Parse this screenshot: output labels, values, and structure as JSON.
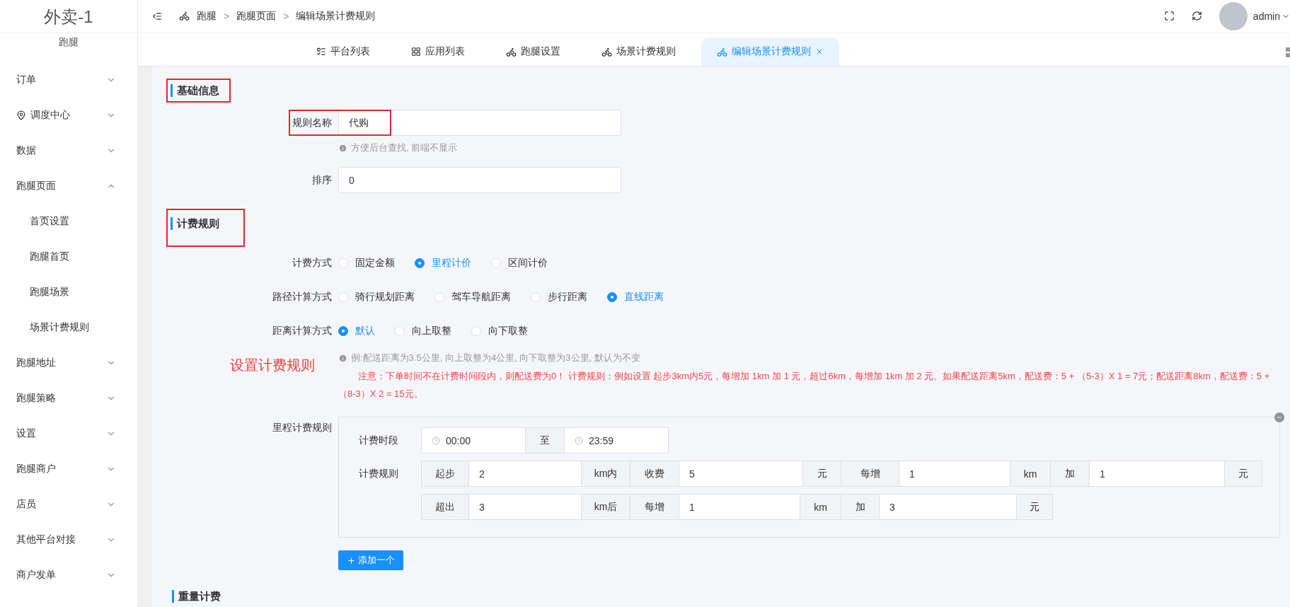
{
  "sidebar": {
    "title": "外卖-1",
    "subtitle": "跑腿",
    "items": [
      {
        "label": "订单",
        "kind": "plain",
        "expanded": false
      },
      {
        "label": "调度中心",
        "kind": "pin",
        "expanded": false
      },
      {
        "label": "数据",
        "kind": "plain",
        "expanded": false
      },
      {
        "label": "跑腿页面",
        "kind": "plain",
        "expanded": true,
        "children": [
          {
            "label": "首页设置"
          },
          {
            "label": "跑腿首页"
          },
          {
            "label": "跑腿场景"
          },
          {
            "label": "场景计费规则"
          }
        ]
      },
      {
        "label": "跑腿地址",
        "kind": "plain",
        "expanded": false
      },
      {
        "label": "跑腿策略",
        "kind": "plain",
        "expanded": false
      },
      {
        "label": "设置",
        "kind": "plain",
        "expanded": false
      },
      {
        "label": "跑腿商户",
        "kind": "plain",
        "expanded": false
      },
      {
        "label": "店员",
        "kind": "plain",
        "expanded": false
      },
      {
        "label": "其他平台对接",
        "kind": "plain",
        "expanded": false
      },
      {
        "label": "商户发单",
        "kind": "plain",
        "expanded": false
      }
    ]
  },
  "header": {
    "breadcrumb": [
      "跑腿",
      "跑腿页面",
      "编辑场景计费规则"
    ],
    "separator": ">",
    "user": "admin"
  },
  "tabs": [
    {
      "label": "平台列表",
      "kind": "list",
      "selected": false
    },
    {
      "label": "应用列表",
      "kind": "grid",
      "selected": false
    },
    {
      "label": "跑腿设置",
      "kind": "scooter",
      "selected": false
    },
    {
      "label": "场景计费规则",
      "kind": "scooter",
      "selected": false
    },
    {
      "label": "编辑场景计费规则",
      "kind": "scooter",
      "selected": true
    }
  ],
  "basic": {
    "title": "基础信息",
    "annotated": true,
    "name_field": {
      "label": "规则名称",
      "value": "代购",
      "hint": "方便后台查找, 前端不显示",
      "annotated": true
    },
    "sort_field": {
      "label": "排序",
      "value": "0"
    }
  },
  "billing": {
    "title": "计费规则",
    "annotated": true,
    "radio_groups": [
      {
        "label": "计费方式",
        "options": [
          {
            "label": "固定金额",
            "selected": false
          },
          {
            "label": "里程计价",
            "selected": true
          },
          {
            "label": "区间计价",
            "selected": false
          }
        ]
      },
      {
        "label": "路径计算方式",
        "options": [
          {
            "label": "骑行规划距离",
            "selected": false
          },
          {
            "label": "驾车导航距离",
            "selected": false
          },
          {
            "label": "步行距离",
            "selected": false
          },
          {
            "label": "直线距离",
            "selected": true
          }
        ]
      },
      {
        "label": "距离计算方式",
        "options": [
          {
            "label": "默认",
            "selected": true
          },
          {
            "label": "向上取整",
            "selected": false
          },
          {
            "label": "向下取整",
            "selected": false
          }
        ]
      }
    ],
    "hint": "例:配送距离为3.5公里, 向上取整为4公里, 向下取整为3公里, 默认为不变",
    "annotation": "设置计费规则",
    "note": "注意：下单时间不在计费时间段内，则配送费为0！ 计费规则：例如设置 起步3km内5元，每增加 1km 加 1 元，超过6km，每增加 1km 加 2 元。如果配送距离5km，配送费：5 + （5-3）X 1 = 7元；配送距离8km，配送费：5 + （8-3）X 2 = 15元。",
    "mileage": {
      "label": "里程计费规则",
      "period_label": "计费时段",
      "start": "00:00",
      "separator": "至",
      "end": "23:59",
      "rule_label": "计费规则",
      "rows": [
        [
          {
            "kind": "addon",
            "text": "起步"
          },
          {
            "kind": "input",
            "value": "2"
          },
          {
            "kind": "addon",
            "text": "km内"
          },
          {
            "kind": "addon",
            "text": "收费"
          },
          {
            "kind": "input",
            "value": "5"
          },
          {
            "kind": "addon",
            "text": "元"
          },
          {
            "kind": "addon",
            "text": "每增"
          },
          {
            "kind": "input",
            "value": "1"
          },
          {
            "kind": "addon",
            "text": "km"
          },
          {
            "kind": "addon",
            "text": "加"
          },
          {
            "kind": "input",
            "value": "1"
          },
          {
            "kind": "addon",
            "text": "元"
          }
        ],
        [
          {
            "kind": "addon",
            "text": "超出"
          },
          {
            "kind": "input",
            "value": "3"
          },
          {
            "kind": "addon",
            "text": "km后"
          },
          {
            "kind": "addon",
            "text": "每增"
          },
          {
            "kind": "input",
            "value": "1"
          },
          {
            "kind": "addon",
            "text": "km"
          },
          {
            "kind": "addon",
            "text": "加"
          },
          {
            "kind": "input",
            "value": "3"
          },
          {
            "kind": "addon",
            "text": "元"
          }
        ]
      ]
    },
    "add_button": "添加一个"
  },
  "weight": {
    "title": "重量计费"
  }
}
